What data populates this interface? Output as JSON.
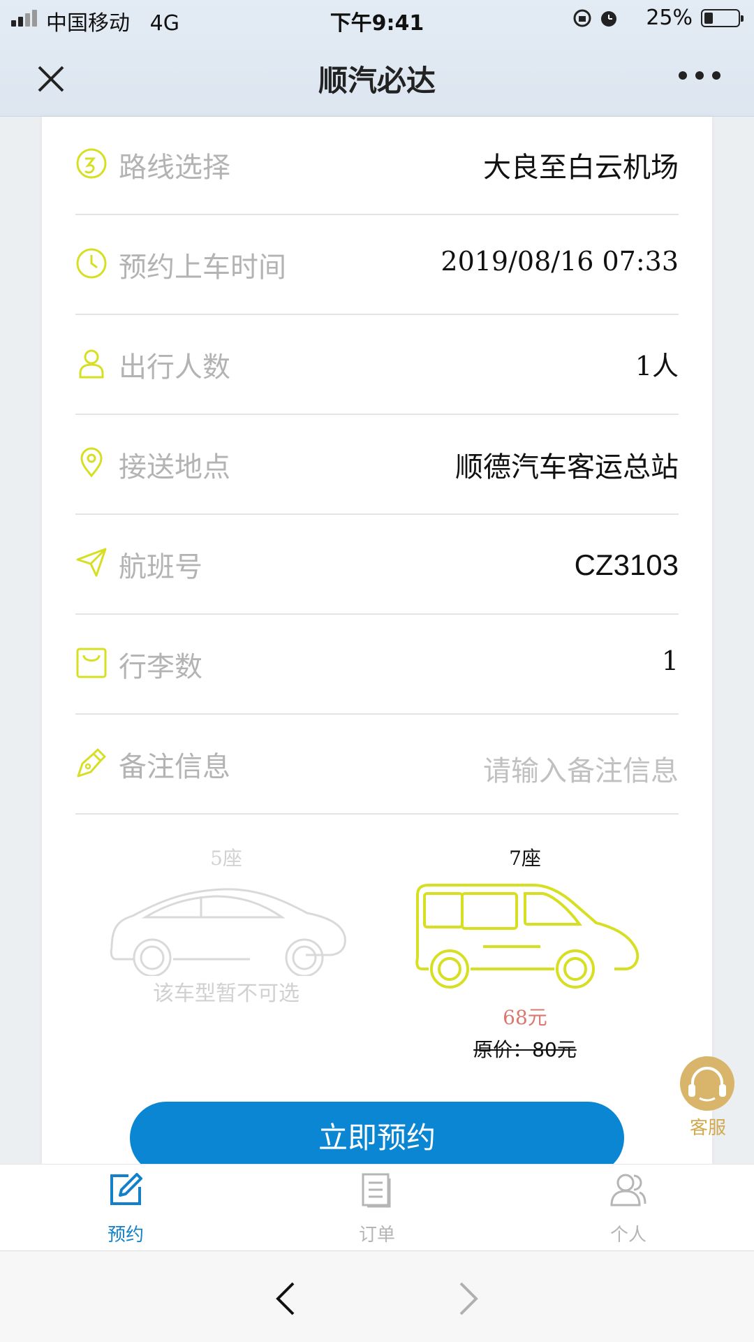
{
  "status_bar": {
    "carrier": "中国移动",
    "network": "4G",
    "time": "下午9:41",
    "battery_percent": "25%",
    "battery_level": 0.25
  },
  "header": {
    "title": "顺汽必达",
    "close_icon": "close-icon",
    "more_icon": "more-dots-icon"
  },
  "form": {
    "route": {
      "label": "路线选择",
      "value": "大良至白云机场",
      "icon": "route-icon"
    },
    "pickup_time": {
      "label": "预约上车时间",
      "value": "2019/08/16 07:33",
      "icon": "clock-icon"
    },
    "passengers": {
      "label": "出行人数",
      "value": "1人",
      "icon": "person-icon"
    },
    "pickup_location": {
      "label": "接送地点",
      "value": "顺德汽车客运总站",
      "icon": "location-pin-icon"
    },
    "flight_no": {
      "label": "航班号",
      "value": "CZ3103",
      "icon": "paper-plane-icon"
    },
    "luggage": {
      "label": "行李数",
      "value": "1",
      "icon": "bag-icon"
    },
    "remarks": {
      "label": "备注信息",
      "placeholder": "请输入备注信息",
      "icon": "pen-icon"
    }
  },
  "vehicles": {
    "sedan": {
      "seats": "5座",
      "note": "该车型暂不可选",
      "available": false
    },
    "van": {
      "seats": "7座",
      "price": "68元",
      "original_price": "原价：80元",
      "available": true
    }
  },
  "book_button": "立即预约",
  "customer_service": {
    "label": "客服"
  },
  "tabs": [
    {
      "label": "预约",
      "icon": "edit-icon",
      "active": true
    },
    {
      "label": "订单",
      "icon": "document-icon",
      "active": false
    },
    {
      "label": "个人",
      "icon": "users-icon",
      "active": false
    }
  ],
  "colors": {
    "accent_icon": "#d6df22",
    "primary": "#0a86d3",
    "price": "#d9786f",
    "service": "#d9b56b",
    "tab_inactive": "#b5b5b5"
  }
}
